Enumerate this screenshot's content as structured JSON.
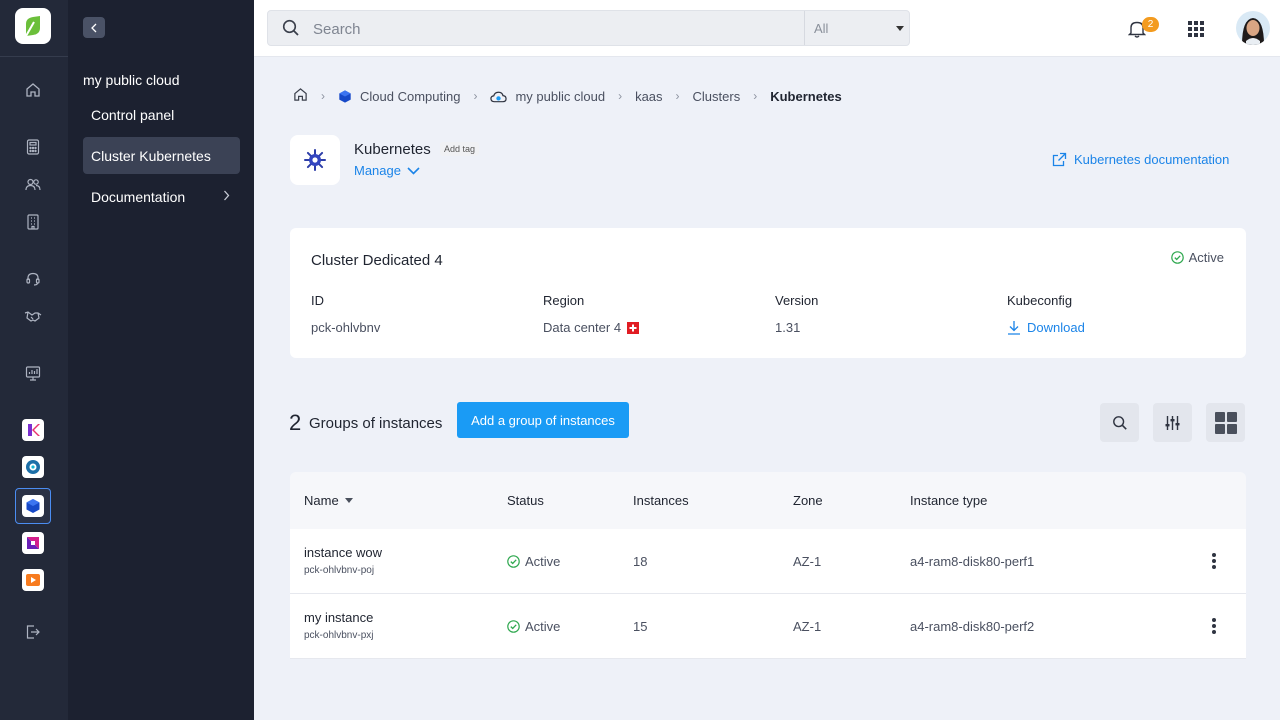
{
  "search": {
    "placeholder": "Search",
    "scope": "All"
  },
  "notifications": {
    "count": "2"
  },
  "sidebar": {
    "title": "my public cloud",
    "items": [
      {
        "label": "Control panel"
      },
      {
        "label": "Cluster Kubernetes"
      },
      {
        "label": "Documentation"
      }
    ]
  },
  "breadcrumb": {
    "items": [
      "Cloud Computing",
      "my public cloud",
      "kaas",
      "Clusters"
    ],
    "current": "Kubernetes"
  },
  "header": {
    "title": "Kubernetes",
    "add_tag": "Add tag",
    "manage": "Manage",
    "doc_link": "Kubernetes documentation"
  },
  "cluster": {
    "name": "Cluster Dedicated 4",
    "status": "Active",
    "id_label": "ID",
    "id_value": "pck-ohlvbnv",
    "region_label": "Region",
    "region_value": "Data center 4",
    "version_label": "Version",
    "version_value": "1.31",
    "kubeconfig_label": "Kubeconfig",
    "kubeconfig_action": "Download"
  },
  "groups": {
    "count": "2",
    "label": "Groups of instances",
    "add_button": "Add a group of instances"
  },
  "table": {
    "headers": {
      "name": "Name",
      "status": "Status",
      "instances": "Instances",
      "zone": "Zone",
      "type": "Instance type"
    },
    "rows": [
      {
        "name": "instance wow",
        "id": "pck-ohlvbnv-poj",
        "status": "Active",
        "instances": "18",
        "zone": "AZ-1",
        "type": "a4-ram8-disk80-perf1"
      },
      {
        "name": "my instance",
        "id": "pck-ohlvbnv-pxj",
        "status": "Active",
        "instances": "15",
        "zone": "AZ-1",
        "type": "a4-ram8-disk80-perf2"
      }
    ]
  },
  "colors": {
    "accent": "#1a9bf5",
    "link": "#1b84e8",
    "success": "#2fa84f",
    "rail": "#232939",
    "sidebar": "#1c2130"
  }
}
